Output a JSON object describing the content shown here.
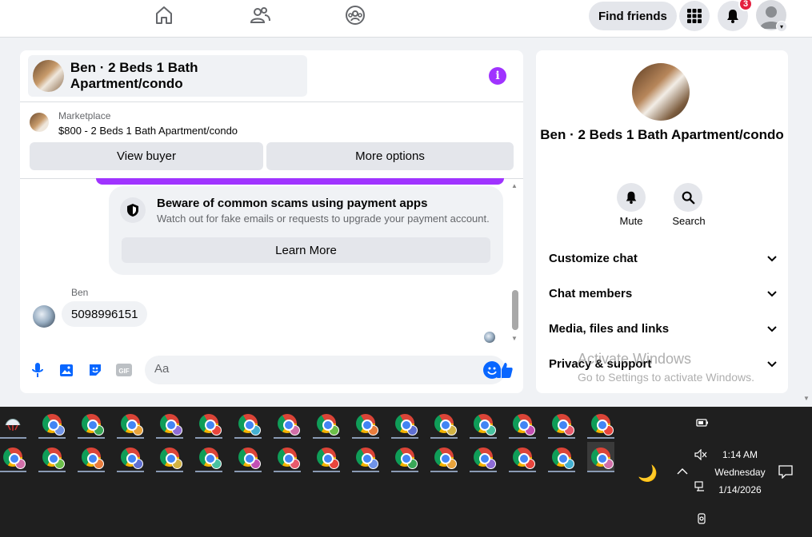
{
  "topbar": {
    "find_friends": "Find friends",
    "notifications_count": "3",
    "icons": [
      "home-icon",
      "friends-icon",
      "groups-icon",
      "apps-grid-icon",
      "bell-icon",
      "profile-avatar"
    ]
  },
  "chat": {
    "title": "Ben · 2 Beds 1 Bath Apartment/condo",
    "marketplace_label": "Marketplace",
    "listing": "$800 - 2 Beds 1 Bath Apartment/condo",
    "view_buyer": "View buyer",
    "more_options": "More options",
    "scam_title": "Beware of common scams using payment apps",
    "scam_subtitle": "Watch out for fake emails or requests to upgrade your payment account.",
    "learn_more": "Learn More",
    "sender": "Ben",
    "message": "5098996151",
    "composer_placeholder": "Aa"
  },
  "details": {
    "title": "Ben · 2 Beds 1 Bath Apartment/condo",
    "mute": "Mute",
    "search": "Search",
    "sections": [
      "Customize chat",
      "Chat members",
      "Media, files and links",
      "Privacy & support"
    ]
  },
  "watermark": {
    "line1": "Activate Windows",
    "line2": "Go to Settings to activate Windows."
  },
  "taskbar": {
    "time": "1:14 AM",
    "day": "Wednesday",
    "date": "1/14/2026"
  },
  "colors": {
    "accent": "#a033ff",
    "blue": "#0866ff",
    "badge": "#e41e3f"
  }
}
